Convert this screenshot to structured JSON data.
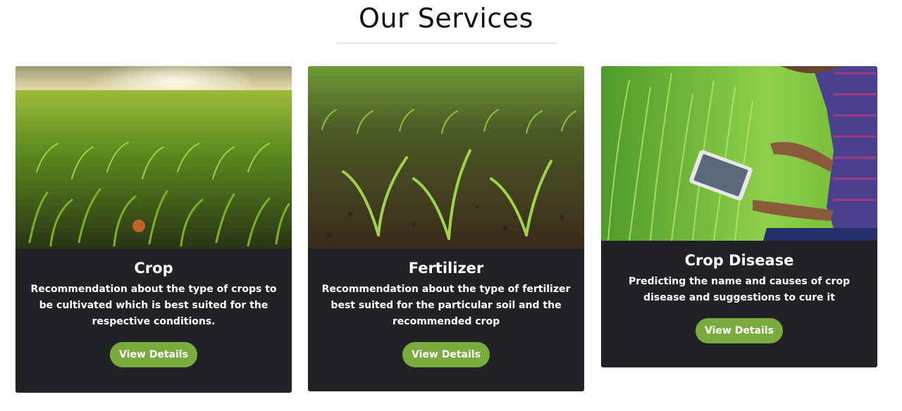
{
  "section": {
    "title": "Our Services"
  },
  "cards": [
    {
      "title": "Crop",
      "description": "Recommendation about the type of crops to be cultivated which is best suited for the respective conditions.",
      "button_label": "View Details",
      "image_icon": "corn-field-sunset-photo"
    },
    {
      "title": "Fertilizer",
      "description": "Recommendation about the type of fertilizer best suited for the particular soil and the recommended crop",
      "button_label": "View Details",
      "image_icon": "corn-seedlings-soil-photo"
    },
    {
      "title": "Crop Disease",
      "description": "Predicting the name and causes of crop disease and suggestions to cure it",
      "button_label": "View Details",
      "image_icon": "farmer-tablet-rice-photo"
    }
  ],
  "colors": {
    "card_bg": "#202226",
    "button_bg": "#7bab3e",
    "text": "#ffffff"
  }
}
